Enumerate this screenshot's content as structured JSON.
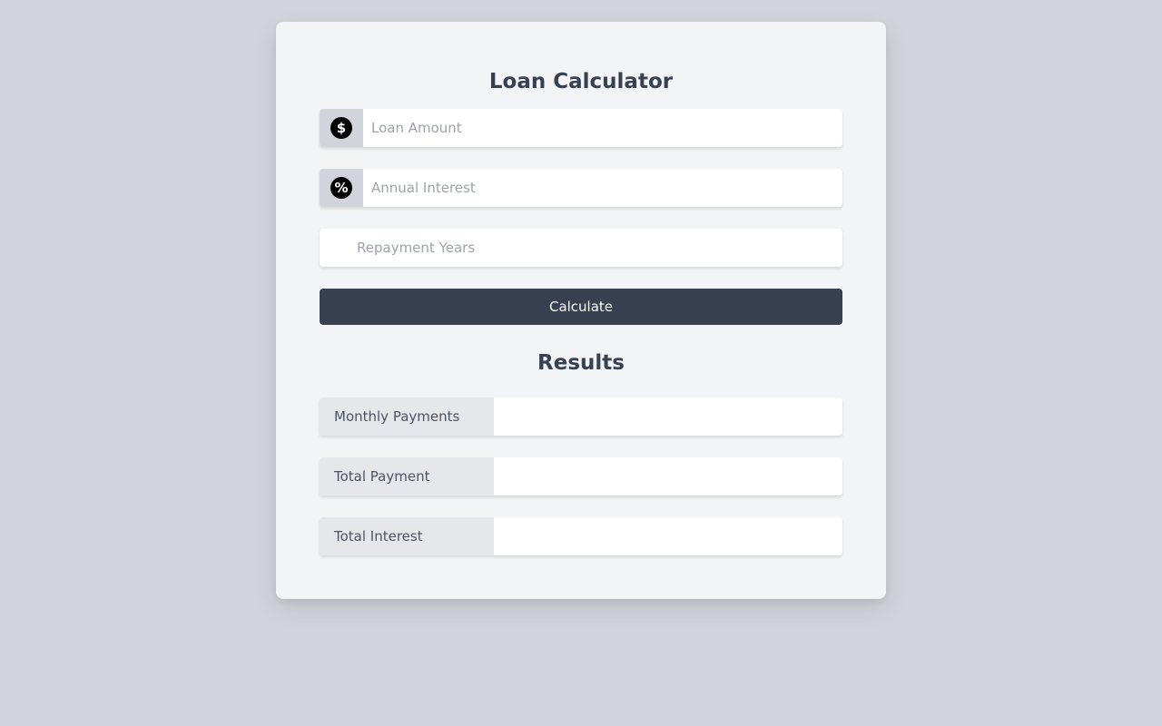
{
  "calculator": {
    "title": "Loan Calculator",
    "fields": [
      {
        "placeholder": "Loan Amount",
        "value": "",
        "icon": "dollar-icon",
        "icon_glyph": "$"
      },
      {
        "placeholder": "Annual Interest",
        "value": "",
        "icon": "percent-icon",
        "icon_glyph": "%"
      },
      {
        "placeholder": "Repayment Years",
        "value": ""
      }
    ],
    "button_label": "Calculate"
  },
  "results": {
    "title": "Results",
    "rows": [
      {
        "label": "Monthly Payments",
        "value": ""
      },
      {
        "label": "Total Payment",
        "value": ""
      },
      {
        "label": "Total Interest",
        "value": ""
      }
    ]
  },
  "colors": {
    "page_background": "#d1d5db",
    "card_background": "#f3f4f6",
    "button_background": "#374151",
    "heading": "#374151"
  }
}
